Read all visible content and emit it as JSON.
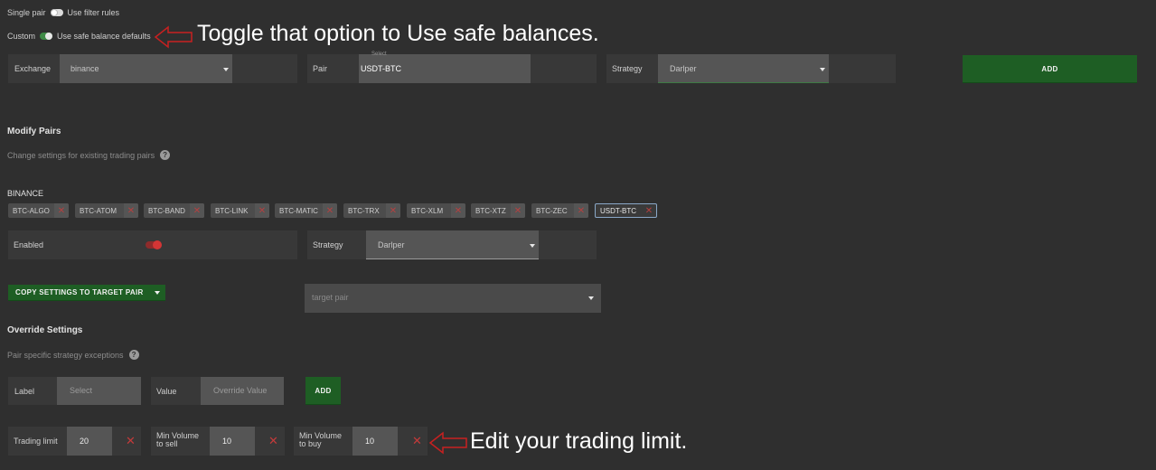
{
  "top": {
    "single_pair_label": "Single pair",
    "use_filter_rules_label": "Use filter rules",
    "custom_label": "Custom",
    "use_safe_balance_label": "Use safe balance defaults"
  },
  "annotations": {
    "toggle_note": "Toggle that option to Use safe balances.",
    "trading_limit_note": "Edit your trading limit."
  },
  "add_row": {
    "exchange_label": "Exchange",
    "exchange_value": "binance",
    "pair_label": "Pair",
    "pair_select_caption": "Select",
    "pair_value": "USDT-BTC",
    "strategy_label": "Strategy",
    "strategy_value": "Darlper",
    "add_label": "ADD"
  },
  "modify": {
    "title": "Modify Pairs",
    "subtitle": "Change settings for existing trading pairs",
    "help": "?",
    "exchange_heading": "BINANCE",
    "pairs": [
      {
        "label": "BTC-ALGO",
        "x": "✕"
      },
      {
        "label": "BTC-ATOM",
        "x": "✕"
      },
      {
        "label": "BTC-BAND",
        "x": "✕"
      },
      {
        "label": "BTC-LINK",
        "x": "✕"
      },
      {
        "label": "BTC-MATIC",
        "x": "✕"
      },
      {
        "label": "BTC-TRX",
        "x": "✕"
      },
      {
        "label": "BTC-XLM",
        "x": "✕"
      },
      {
        "label": "BTC-XTZ",
        "x": "✕"
      },
      {
        "label": "BTC-ZEC",
        "x": "✕"
      },
      {
        "label": "USDT-BTC",
        "x": "✕"
      }
    ],
    "enabled_label": "Enabled",
    "strategy_label": "Strategy",
    "strategy_value": "Darlper",
    "copy_button": "COPY SETTINGS TO TARGET PAIR",
    "target_pair_placeholder": "target pair"
  },
  "override": {
    "title": "Override Settings",
    "subtitle": "Pair specific strategy exceptions",
    "help": "?",
    "label_label": "Label",
    "label_placeholder": "Select",
    "value_label": "Value",
    "value_placeholder": "Override Value",
    "add_label": "ADD"
  },
  "limits": {
    "trading_limit_label": "Trading limit",
    "trading_limit_value": "20",
    "min_vol_sell_label_1": "Min Volume",
    "min_vol_sell_label_2": "to sell",
    "min_vol_sell_value": "10",
    "min_vol_buy_label_1": "Min Volume",
    "min_vol_buy_label_2": "to buy",
    "min_vol_buy_value": "10",
    "x": "✕"
  },
  "colors": {
    "background": "#2f2f2f",
    "accent_green": "#1e5e24",
    "toggle_on": "#3e8a46",
    "enabled_toggle": "#c83333",
    "annotation_arrow": "#c82020"
  }
}
